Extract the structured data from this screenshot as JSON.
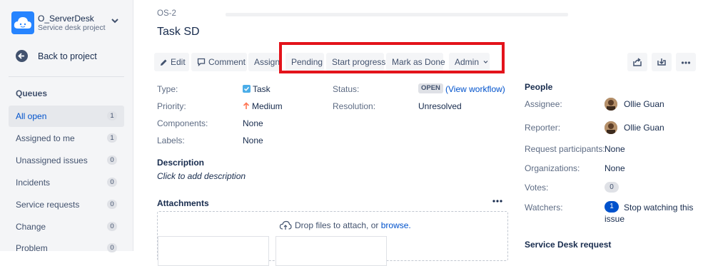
{
  "sidebar": {
    "project_name": "O_ServerDesk",
    "project_type": "Service desk project",
    "back_label": "Back to project",
    "queues_title": "Queues",
    "queues": [
      {
        "label": "All open",
        "count": "1"
      },
      {
        "label": "Assigned to me",
        "count": "1"
      },
      {
        "label": "Unassigned issues",
        "count": "0"
      },
      {
        "label": "Incidents",
        "count": "0"
      },
      {
        "label": "Service requests",
        "count": "0"
      },
      {
        "label": "Change",
        "count": "0"
      },
      {
        "label": "Problem",
        "count": "0"
      }
    ]
  },
  "issue": {
    "key": "OS-2",
    "title": "Task SD"
  },
  "toolbar": {
    "edit": "Edit",
    "comment": "Comment",
    "assign": "Assign",
    "pending": "Pending",
    "start_progress": "Start progress",
    "mark_done": "Mark as Done",
    "admin": "Admin"
  },
  "details": {
    "type_label": "Type:",
    "type_value": "Task",
    "priority_label": "Priority:",
    "priority_value": "Medium",
    "components_label": "Components:",
    "components_value": "None",
    "labels_label": "Labels:",
    "labels_value": "None",
    "status_label": "Status:",
    "status_value": "OPEN",
    "view_workflow": "(View workflow)",
    "resolution_label": "Resolution:",
    "resolution_value": "Unresolved"
  },
  "description": {
    "title": "Description",
    "placeholder": "Click to add description"
  },
  "attachments": {
    "title": "Attachments",
    "drop_text": "Drop files to attach, or",
    "browse": "browse."
  },
  "people": {
    "title": "People",
    "assignee_label": "Assignee:",
    "assignee": "Ollie Guan",
    "reporter_label": "Reporter:",
    "reporter": "Ollie Guan",
    "participants_label": "Request participants:",
    "participants": "None",
    "organizations_label": "Organizations:",
    "organizations": "None",
    "votes_label": "Votes:",
    "votes": "0",
    "watchers_label": "Watchers:",
    "watchers_count": "1",
    "watch_link_1": "Stop watching this",
    "watch_link_2": "issue",
    "service_desk_title": "Service Desk request"
  },
  "colors": {
    "accent": "#0052cc",
    "highlight": "#e3131b",
    "sidebar_bg": "#f4f5f7"
  }
}
